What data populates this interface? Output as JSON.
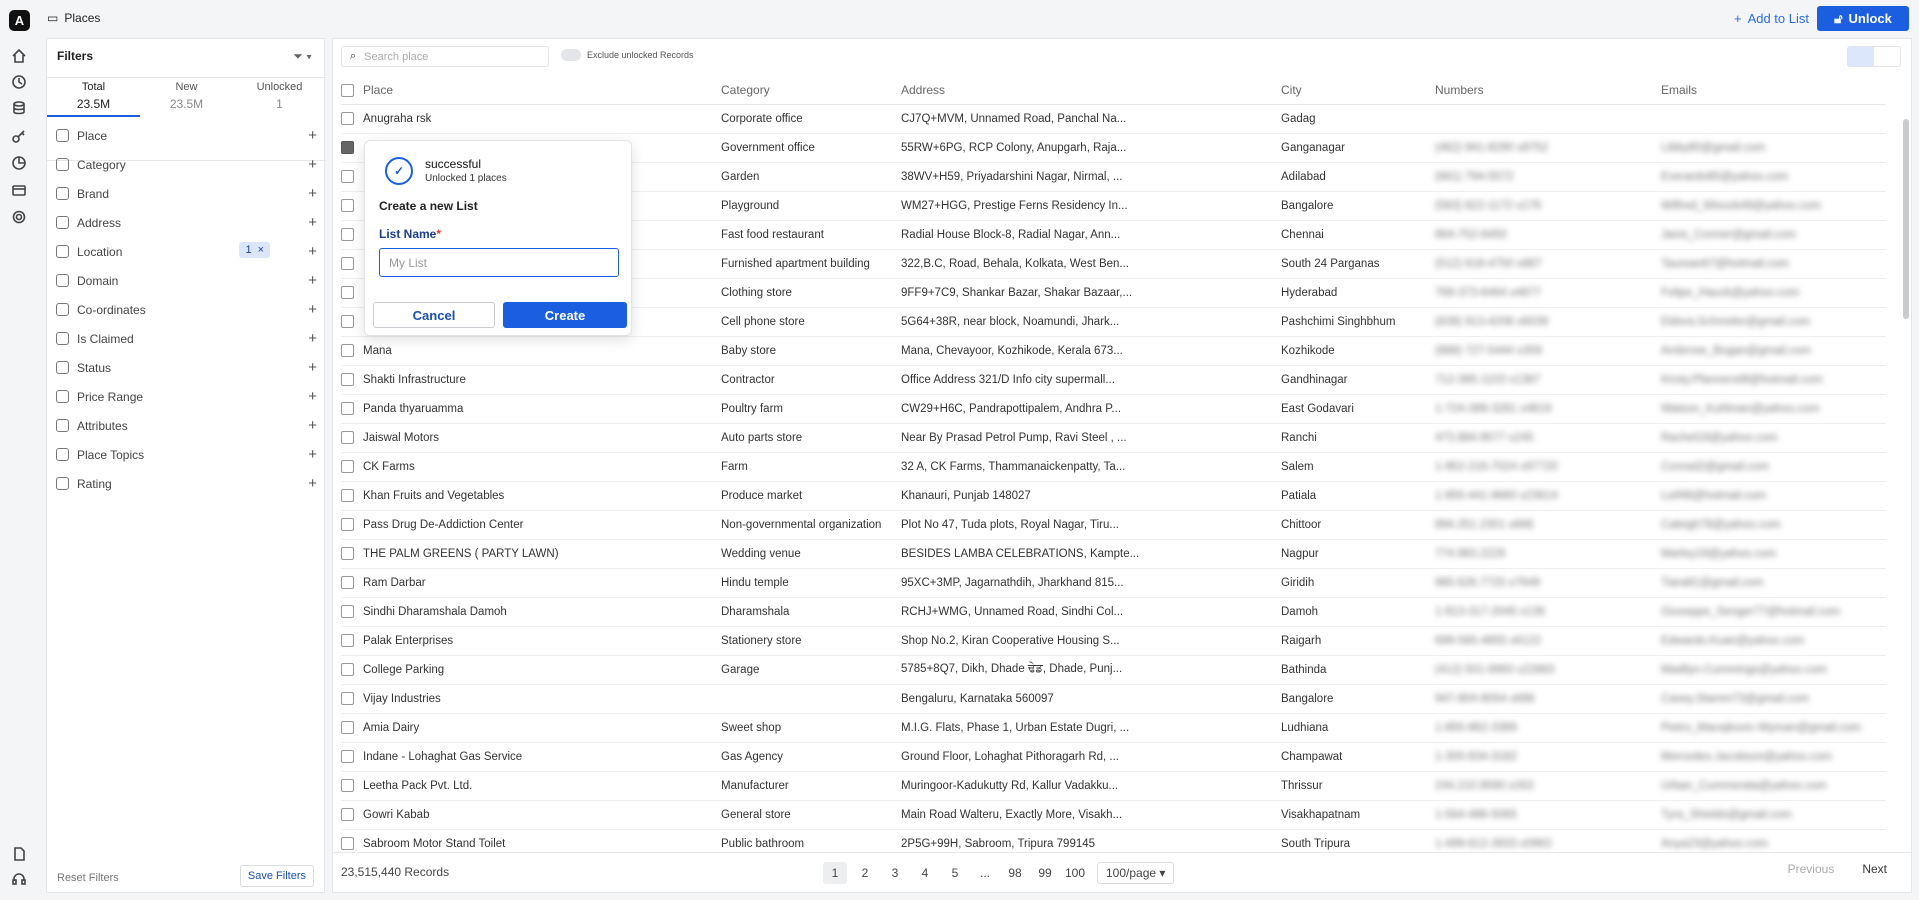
{
  "app": {
    "logo": "A",
    "title": "Places"
  },
  "header": {
    "add_to_list": "Add to List",
    "unlock": "Unlock"
  },
  "filters": {
    "title": "Filters",
    "tabs": [
      {
        "label": "Total",
        "count": "23.5M"
      },
      {
        "label": "New",
        "count": "23.5M"
      },
      {
        "label": "Unlocked",
        "count": "1"
      }
    ],
    "items": [
      "Place",
      "Category",
      "Brand",
      "Address",
      "Location",
      "Domain",
      "Co-ordinates",
      "Is Claimed",
      "Status",
      "Price Range",
      "Attributes",
      "Place Topics",
      "Rating"
    ],
    "location_badge": "1",
    "reset": "Reset Filters",
    "save": "Save Filters"
  },
  "toolbar": {
    "search_placeholder": "Search place",
    "exclude_label": "Exclude unlocked Records"
  },
  "table": {
    "columns": [
      "Place",
      "Category",
      "Address",
      "City",
      "Numbers",
      "Emails"
    ],
    "rows": [
      [
        "Anugraha rsk",
        "Corporate office",
        "CJ7Q+MVM, Unnamed Road, Panchal Na...",
        "Gadag",
        "",
        ""
      ],
      [
        "",
        "Government office",
        "55RW+6PG, RCP Colony, Anupgarh, Raja...",
        "Ganganagar",
        "(462) 941-8290 x8752",
        "Libby80@gmail.com"
      ],
      [
        "",
        "Garden",
        "38WV+H59, Priyadarshini Nagar, Nirmal, ...",
        "Adilabad",
        "(661) 794-5572",
        "Everardo85@yahoo.com"
      ],
      [
        "",
        "Playground",
        "WM27+HGG, Prestige Ferns Residency In...",
        "Bangalore",
        "(583) 822-1172 x179",
        "Wilfred_Wisozk49@yahoo.com"
      ],
      [
        "",
        "Fast food restaurant",
        "Radial House Block-8, Radial Nagar, Ann...",
        "Chennai",
        "864-752-6450",
        "Janis_Conner@gmail.com"
      ],
      [
        "",
        "Furnished apartment building",
        "322,B.C, Road, Behala, Kolkata, West Ben...",
        "South 24 Parganas",
        "(512) 618-4750 x867",
        "Taurean67@hotmail.com"
      ],
      [
        "",
        "Clothing store",
        "9FF9+7C9, Shankar Bazar, Shakar Bazaar,...",
        "Hyderabad",
        "769-373-6464 x4877",
        "Felipe_Hauck@yahoo.com"
      ],
      [
        "",
        "Cell phone store",
        "5G64+38R, near block, Noamundi, Jhark...",
        "Pashchimi Singhbhum",
        "(639) 913-4208 x6039",
        "Eldora.Schmeler@gmail.com"
      ],
      [
        "Mana",
        "Baby store",
        "Mana, Chevayoor, Kozhikode, Kerala 673...",
        "Kozhikode",
        "(888) 727-5444 x359",
        "Ambrose_Bogan@gmail.com"
      ],
      [
        "Shakti Infrastructure",
        "Contractor",
        "Office Address 321/D Info city supermall...",
        "Gandhinagar",
        "712-385-1103 x1387",
        "Kirsty.Pfannerstill@hotmail.com"
      ],
      [
        "Panda thyaruamma",
        "Poultry farm",
        "CW29+H6C, Pandrapottipalem, Andhra P...",
        "East Godavari",
        "1-724-389-3281 x4819",
        "Watson_Kuhlman@yahoo.com"
      ],
      [
        "Jaiswal Motors",
        "Auto parts store",
        "Near By Prasad Petrol Pump, Ravi Steel , ...",
        "Ranchi",
        "473.884.9577 x245",
        "Rachel18@yahoo.com"
      ],
      [
        "CK Farms",
        "Farm",
        "32 A, CK Farms, Thammanaickenpatty, Ta...",
        "Salem",
        "1-952-216-7024 x97720",
        "Conrad2@gmail.com"
      ],
      [
        "Khan Fruits and Vegetables",
        "Produce market",
        "Khanauri, Punjab 148027",
        "Patiala",
        "1-955-441-9660 x23614",
        "Leif48@hotmail.com"
      ],
      [
        "Pass Drug De-Addiction Center",
        "Non-governmental organization",
        "Plot No 47, Tuda plots, Royal Nagar, Tiru...",
        "Chittoor",
        "894.251.2301 x666",
        "Caleigh78@yahoo.com"
      ],
      [
        "THE PALM GREENS ( PARTY LAWN)",
        "Wedding venue",
        "BESIDES LAMBA CELEBRATIONS, Kampte...",
        "Nagpur",
        "774.983.2229",
        "Marley19@yahoo.com"
      ],
      [
        "Ram Darbar",
        "Hindu temple",
        "95XC+3MP, Jagarnathdih, Jharkhand 815...",
        "Giridih",
        "985.626.7725 x7649",
        "Tiara81@gmail.com"
      ],
      [
        "Sindhi Dharamshala Damoh",
        "Dharamshala",
        "RCHJ+WMG, Unnamed Road, Sindhi Col...",
        "Damoh",
        "1-813-317-2045 x136",
        "Giuseppe_Senger77@hotmail.com"
      ],
      [
        "Palak Enterprises",
        "Stationery store",
        "Shop No.2, Kiran Cooperative Housing S...",
        "Raigarh",
        "699-565-4855 x6122",
        "Edwardo.Kuan@yahoo.com"
      ],
      [
        "College Parking",
        "Garage",
        "5785+8Q7, Dikh, Dhade ਢੇਡ, Dhade, Punj...",
        "Bathinda",
        "(412) 501-9993 x22883",
        "Madilyn.Cummings@yahoo.com"
      ],
      [
        "Vijay Industries",
        "",
        "Bengaluru, Karnataka 560097",
        "Bangalore",
        "947-804-8054 x686",
        "Casey.Stamm73@gmail.com"
      ],
      [
        "Amia Dairy",
        "Sweet shop",
        "M.I.G. Flats, Phase 1, Urban Estate Dugri, ...",
        "Ludhiana",
        "1-855-862-3389",
        "Pietro_Macejkovic-Wyman@gmail.com"
      ],
      [
        "Indane - Lohaghat Gas Service",
        "Gas Agency",
        "Ground Floor, Lohaghat Pithoragarh Rd, ...",
        "Champawat",
        "1-300-934-3182",
        "Mercedes.Jacobson@yahoo.com"
      ],
      [
        "Leetha Pack Pvt. Ltd.",
        "Manufacturer",
        "Muringoor-Kadukutty Rd, Kallur Vadakku...",
        "Thrissur",
        "244.210.9590 x263",
        "Urban_Cummerata@yahoo.com"
      ],
      [
        "Gowri Kabab",
        "General store",
        "Main Road Walteru, Exactly More, Visakh...",
        "Visakhapatnam",
        "1-564-486-5065",
        "Tyra_Shields@gmail.com"
      ],
      [
        "Sabroom Motor Stand Toilet",
        "Public bathroom",
        "2P5G+99H, Sabroom, Tripura 799145",
        "South Tripura",
        "1-499-612-3933 x0963",
        "Anya23@yahoo.com"
      ]
    ],
    "checked_row": 1
  },
  "footer": {
    "records": "23,515,440 Records",
    "pages": [
      "1",
      "2",
      "3",
      "4",
      "5",
      "...",
      "98",
      "99",
      "100"
    ],
    "per_page": "100/page",
    "previous": "Previous",
    "next": "Next"
  },
  "modal": {
    "toast_title": "successful",
    "toast_sub": "Unlocked 1 places",
    "heading": "Create a new List",
    "label": "List Name",
    "required": "*",
    "placeholder": "My List",
    "cancel": "Cancel",
    "create": "Create"
  }
}
